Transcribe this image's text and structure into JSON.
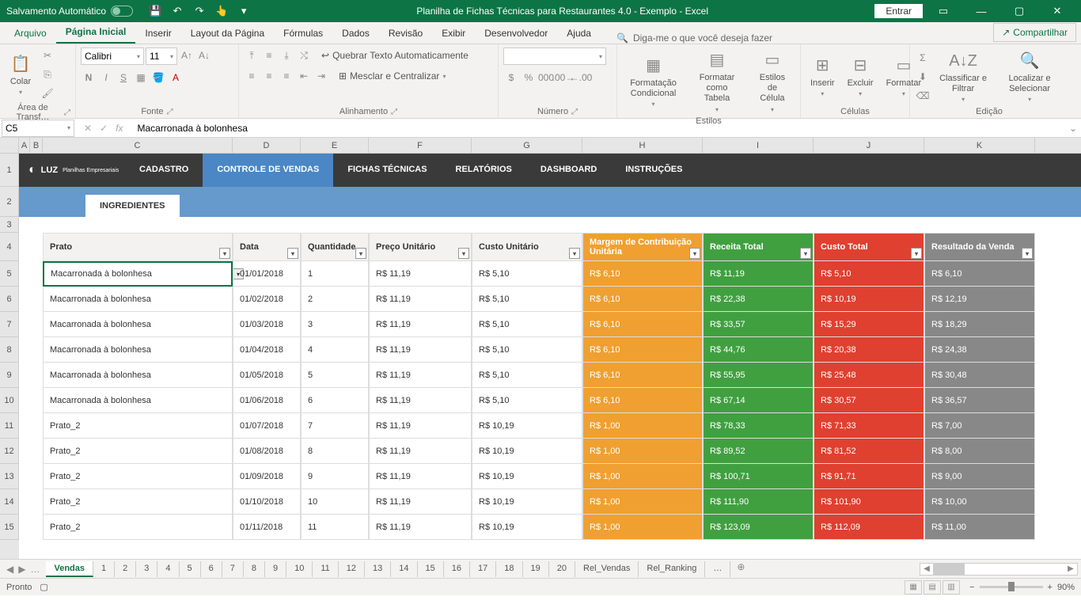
{
  "titlebar": {
    "autosave": "Salvamento Automático",
    "title": "Planilha de Fichas Técnicas para Restaurantes 4.0 - Exemplo  -  Excel",
    "entrar": "Entrar"
  },
  "tabs": {
    "file": "Arquivo",
    "home": "Página Inicial",
    "insert": "Inserir",
    "layout": "Layout da Página",
    "formulas": "Fórmulas",
    "data": "Dados",
    "review": "Revisão",
    "view": "Exibir",
    "developer": "Desenvolvedor",
    "help": "Ajuda",
    "tellme": "Diga-me o que você deseja fazer",
    "share": "Compartilhar"
  },
  "ribbon": {
    "clipboard": {
      "paste": "Colar",
      "label": "Área de Transf…"
    },
    "font": {
      "name": "Calibri",
      "size": "11",
      "label": "Fonte"
    },
    "alignment": {
      "wrap": "Quebrar Texto Automaticamente",
      "merge": "Mesclar e Centralizar",
      "label": "Alinhamento"
    },
    "number": {
      "label": "Número"
    },
    "styles": {
      "cond": "Formatação Condicional",
      "table": "Formatar como Tabela",
      "cell": "Estilos de Célula",
      "label": "Estilos"
    },
    "cells": {
      "insert": "Inserir",
      "delete": "Excluir",
      "format": "Formatar",
      "label": "Células"
    },
    "editing": {
      "sort": "Classificar e Filtrar",
      "find": "Localizar e Selecionar",
      "label": "Edição"
    }
  },
  "formulabar": {
    "cell": "C5",
    "formula": "Macarronada à bolonhesa"
  },
  "columns": [
    "A",
    "B",
    "C",
    "D",
    "E",
    "F",
    "G",
    "H",
    "I",
    "J",
    "K"
  ],
  "rowlabels": [
    "1",
    "2",
    "3",
    "4",
    "5",
    "6",
    "7",
    "8",
    "9",
    "10",
    "11",
    "12",
    "13",
    "14",
    "15"
  ],
  "sheet": {
    "logo": "LUZ",
    "logoSub": "Planilhas\nEmpresariais",
    "nav": [
      "CADASTRO",
      "CONTROLE\nDE VENDAS",
      "FICHAS\nTÉCNICAS",
      "RELATÓRIOS",
      "DASHBOARD",
      "INSTRUÇÕES"
    ],
    "subtab": "INGREDIENTES",
    "headers": [
      "Prato",
      "Data",
      "Quantidade",
      "Preço Unitário",
      "Custo Unitário",
      "Margem de Contribuição Unitária",
      "Receita Total",
      "Custo Total",
      "Resultado da Venda"
    ],
    "rows": [
      {
        "prato": "Macarronada à bolonhesa",
        "data": "01/01/2018",
        "qtd": "1",
        "preco": "R$ 11,19",
        "custo": "R$ 5,10",
        "margem": "R$ 6,10",
        "receita": "R$ 11,19",
        "custot": "R$ 5,10",
        "result": "R$ 6,10"
      },
      {
        "prato": "Macarronada à bolonhesa",
        "data": "01/02/2018",
        "qtd": "2",
        "preco": "R$ 11,19",
        "custo": "R$ 5,10",
        "margem": "R$ 6,10",
        "receita": "R$ 22,38",
        "custot": "R$ 10,19",
        "result": "R$ 12,19"
      },
      {
        "prato": "Macarronada à bolonhesa",
        "data": "01/03/2018",
        "qtd": "3",
        "preco": "R$ 11,19",
        "custo": "R$ 5,10",
        "margem": "R$ 6,10",
        "receita": "R$ 33,57",
        "custot": "R$ 15,29",
        "result": "R$ 18,29"
      },
      {
        "prato": "Macarronada à bolonhesa",
        "data": "01/04/2018",
        "qtd": "4",
        "preco": "R$ 11,19",
        "custo": "R$ 5,10",
        "margem": "R$ 6,10",
        "receita": "R$ 44,76",
        "custot": "R$ 20,38",
        "result": "R$ 24,38"
      },
      {
        "prato": "Macarronada à bolonhesa",
        "data": "01/05/2018",
        "qtd": "5",
        "preco": "R$ 11,19",
        "custo": "R$ 5,10",
        "margem": "R$ 6,10",
        "receita": "R$ 55,95",
        "custot": "R$ 25,48",
        "result": "R$ 30,48"
      },
      {
        "prato": "Macarronada à bolonhesa",
        "data": "01/06/2018",
        "qtd": "6",
        "preco": "R$ 11,19",
        "custo": "R$ 5,10",
        "margem": "R$ 6,10",
        "receita": "R$ 67,14",
        "custot": "R$ 30,57",
        "result": "R$ 36,57"
      },
      {
        "prato": "Prato_2",
        "data": "01/07/2018",
        "qtd": "7",
        "preco": "R$ 11,19",
        "custo": "R$ 10,19",
        "margem": "R$ 1,00",
        "receita": "R$ 78,33",
        "custot": "R$ 71,33",
        "result": "R$ 7,00"
      },
      {
        "prato": "Prato_2",
        "data": "01/08/2018",
        "qtd": "8",
        "preco": "R$ 11,19",
        "custo": "R$ 10,19",
        "margem": "R$ 1,00",
        "receita": "R$ 89,52",
        "custot": "R$ 81,52",
        "result": "R$ 8,00"
      },
      {
        "prato": "Prato_2",
        "data": "01/09/2018",
        "qtd": "9",
        "preco": "R$ 11,19",
        "custo": "R$ 10,19",
        "margem": "R$ 1,00",
        "receita": "R$ 100,71",
        "custot": "R$ 91,71",
        "result": "R$ 9,00"
      },
      {
        "prato": "Prato_2",
        "data": "01/10/2018",
        "qtd": "10",
        "preco": "R$ 11,19",
        "custo": "R$ 10,19",
        "margem": "R$ 1,00",
        "receita": "R$ 111,90",
        "custot": "R$ 101,90",
        "result": "R$ 10,00"
      },
      {
        "prato": "Prato_2",
        "data": "01/11/2018",
        "qtd": "11",
        "preco": "R$ 11,19",
        "custo": "R$ 10,19",
        "margem": "R$ 1,00",
        "receita": "R$ 123,09",
        "custot": "R$ 112,09",
        "result": "R$ 11,00"
      }
    ]
  },
  "sheettabs": {
    "active": "Vendas",
    "nums": [
      "1",
      "2",
      "3",
      "4",
      "5",
      "6",
      "7",
      "8",
      "9",
      "10",
      "11",
      "12",
      "13",
      "14",
      "15",
      "16",
      "17",
      "18",
      "19",
      "20"
    ],
    "named": [
      "Rel_Vendas",
      "Rel_Ranking"
    ]
  },
  "status": {
    "ready": "Pronto",
    "zoom": "90%"
  },
  "colwidths": {
    "A": 14,
    "B": 16,
    "C": 240,
    "D": 86,
    "E": 86,
    "F": 130,
    "G": 140,
    "H": 152,
    "I": 140,
    "J": 140,
    "K": 140
  }
}
